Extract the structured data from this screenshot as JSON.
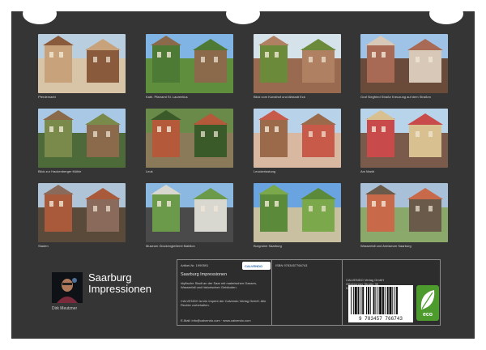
{
  "calendar": {
    "title_line1": "Saarburg",
    "title_line2": "Impressionen",
    "author": "Dirk Meutzner"
  },
  "photos": [
    {
      "caption": "Pferdemarkt",
      "colors": [
        "#b9cfe0",
        "#c8a27a",
        "#8a5a3c",
        "#d8c4a6"
      ]
    },
    {
      "caption": "Kath. Pfarramt St. Laurentius",
      "colors": [
        "#7fb4e4",
        "#4d7a34",
        "#8a6a4a",
        "#5f8f3d"
      ]
    },
    {
      "caption": "Blick vom Kunsthof und Altstadt Eck",
      "colors": [
        "#d6e2ea",
        "#6b8a3a",
        "#b08062",
        "#9a6a50"
      ]
    },
    {
      "caption": "Graf Siegfried Straße Kreuzung auf dem Straßen",
      "colors": [
        "#9fc3e6",
        "#a86a54",
        "#d8c8b8",
        "#6a4a3a"
      ]
    },
    {
      "caption": "Blick zur Hackenberger Mühle",
      "colors": [
        "#a8c8e6",
        "#7a8a4a",
        "#8a6a4a",
        "#4e6a3a"
      ]
    },
    {
      "caption": "Leuk",
      "colors": [
        "#6a8a4a",
        "#b45a3a",
        "#3a5a2a",
        "#8a7a5a"
      ]
    },
    {
      "caption": "Leuckerlastung",
      "colors": [
        "#b8d2ea",
        "#9a6a4a",
        "#c85a4a",
        "#d8b8a0"
      ]
    },
    {
      "caption": "Am Markt",
      "colors": [
        "#b8d4ea",
        "#c84a4a",
        "#d8c090",
        "#7a5a4a"
      ]
    },
    {
      "caption": "Staden",
      "colors": [
        "#b0c4d8",
        "#a85a3a",
        "#8a6a5a",
        "#5a4a3a"
      ]
    },
    {
      "caption": "Museum Glockengießerei Mabilon",
      "colors": [
        "#8ab8e0",
        "#6a9a4a",
        "#d8d8d0",
        "#4a4a4a"
      ]
    },
    {
      "caption": "Burgruine Saarburg",
      "colors": [
        "#6aa4e0",
        "#5a8a3a",
        "#7aa84a",
        "#c8c0a0"
      ]
    },
    {
      "caption": "Wasserfall und Amüseum Saarburg",
      "colors": [
        "#a8c0d8",
        "#c86a4a",
        "#6a5a4a",
        "#8aa86a"
      ]
    }
  ],
  "info": {
    "article_label": "Artikel-Nr. 1990591",
    "product_title": "Saarburg Impressionen",
    "description": "Idyllische Stadt an der Saar mit malerischen Gassen, Wasserfall und historischen Gebäuden.",
    "legal_text": "CALVENDO ist ein Imprint der Calvendo Verlag GmbH. Alle Rechte vorbehalten.",
    "email": "E-Mail: info@calvendo.com · www.calvendo.com",
    "isbn": "ISBN 9783457766743",
    "publisher_name": "CALVENDO Verlag GmbH",
    "publisher_street": "Ottobrunner Straße 39",
    "publisher_city": "D-82008 Unterhaching",
    "logo_text": "CALVENDO",
    "barcode_number": "9 783457 766743",
    "eco_label": "eco"
  }
}
